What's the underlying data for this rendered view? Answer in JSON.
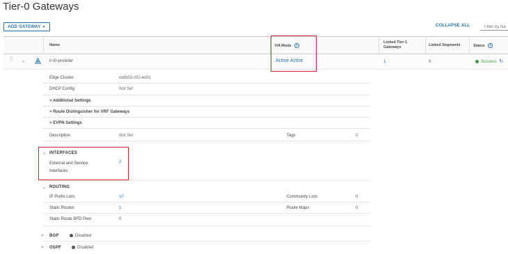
{
  "page": {
    "title": "Tier-0 Gateways"
  },
  "toolbar": {
    "add_label": "ADD GATEWAY",
    "collapse_label": "COLLAPSE ALL",
    "filter_placeholder": "Filter by Na"
  },
  "table": {
    "headers": {
      "name": "Name",
      "ha_mode": "HA Mode",
      "linked_t1": "Linked Tier-1 Gateways",
      "linked_segments": "Linked Segments",
      "status": "Status"
    },
    "row": {
      "name": "lr-t0-provider",
      "ha_mode": "Active Active",
      "linked_t1": "1",
      "linked_segments": "0",
      "status": "Success"
    }
  },
  "details": {
    "edge_cluster_label": "Edge Cluster",
    "edge_cluster_value": "vxdc02-c01-ec01",
    "dhcp_label": "DHCP Config",
    "dhcp_value": "Not Set",
    "additional_settings": "Additional Settings",
    "route_distinguisher": "Route Distinguisher for VRF Gateways",
    "evpn_settings": "EVPN Settings",
    "description_label": "Description",
    "description_value": "Not Set",
    "tags_label": "Tags",
    "tags_value": "0"
  },
  "interfaces": {
    "header": "INTERFACES",
    "ext_label": "External and Service Interfaces",
    "ext_value": "2"
  },
  "routing": {
    "header": "ROUTING",
    "ip_prefix_label": "IP Prefix Lists",
    "ip_prefix_value": "10",
    "community_label": "Community Lists",
    "community_value": "0",
    "static_routes_label": "Static Routes",
    "static_routes_value": "1",
    "route_maps_label": "Route Maps",
    "route_maps_value": "0",
    "bfd_label": "Static Route BFD Peer",
    "bfd_value": "0"
  },
  "bgp": {
    "label": "BGP",
    "status": "Disabled"
  },
  "ospf": {
    "label": "OSPF",
    "status": "Disabled"
  },
  "colors": {
    "accent": "#1b6fb0",
    "success": "#3a9a3a",
    "highlight": "#d12828",
    "disabled": "#666666"
  }
}
